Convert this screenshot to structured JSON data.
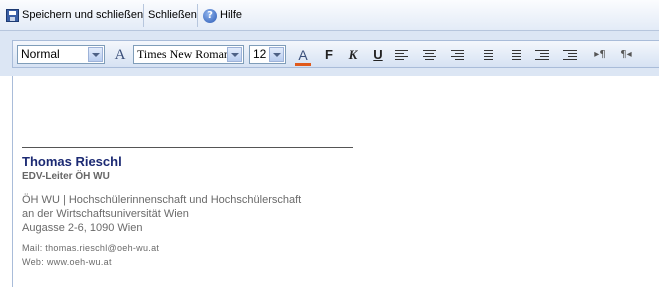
{
  "commandbar": {
    "save_close_label": "Speichern und schließen",
    "close_label": "Schließen",
    "help_label": "Hilfe",
    "help_glyph": "?"
  },
  "toolbar": {
    "style_value": "Normal",
    "font_value": "Times New Roman",
    "size_value": "12",
    "font_icon_glyph": "A",
    "color_glyph": "A",
    "bold_glyph": "F",
    "italic_glyph": "K",
    "underline_glyph": "U",
    "ltr_glyph": "▸¶",
    "rtl_glyph": "¶◂",
    "accent_color": "#e05a1c"
  },
  "signature": {
    "name": "Thomas Rieschl",
    "title": "EDV-Leiter ÖH WU",
    "org_line1": "ÖH WU | Hochschülerinnenschaft und Hochschülerschaft",
    "org_line2": "an der Wirtschaftsuniversität Wien",
    "address": "Augasse 2-6, 1090 Wien",
    "mail": "Mail: thomas.rieschl@oeh-wu.at",
    "web": "Web: www.oeh-wu.at"
  }
}
